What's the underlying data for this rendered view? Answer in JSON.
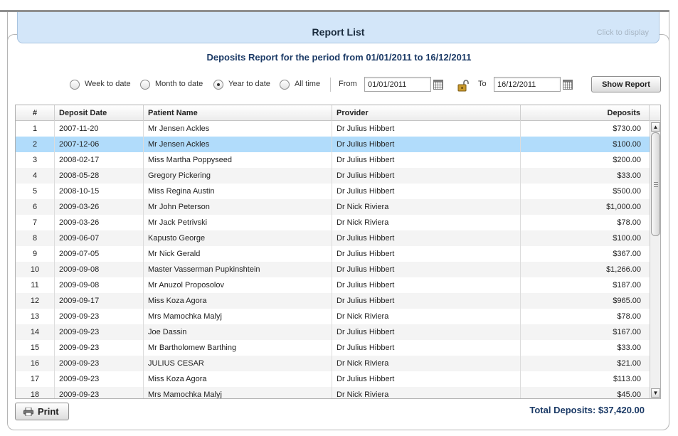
{
  "header": {
    "title": "Report List",
    "hint": "Click to display"
  },
  "report": {
    "title": "Deposits Report for the period from 01/01/2011 to 16/12/2011"
  },
  "filters": {
    "options": [
      {
        "label": "Week to date",
        "checked": false
      },
      {
        "label": "Month to date",
        "checked": false
      },
      {
        "label": "Year to date",
        "checked": true
      },
      {
        "label": "All time",
        "checked": false
      }
    ],
    "from_label": "From",
    "from_value": "01/01/2011",
    "to_label": "To",
    "to_value": "16/12/2011",
    "show_button": "Show Report"
  },
  "table": {
    "columns": [
      "#",
      "Deposit Date",
      "Patient Name",
      "Provider",
      "Deposits"
    ],
    "selected_row": 2,
    "rows": [
      [
        "1",
        "2007-11-20",
        "Mr Jensen Ackles",
        "Dr Julius Hibbert",
        "$730.00"
      ],
      [
        "2",
        "2007-12-06",
        "Mr Jensen Ackles",
        "Dr Julius Hibbert",
        "$100.00"
      ],
      [
        "3",
        "2008-02-17",
        "Miss Martha Poppyseed",
        "Dr Julius Hibbert",
        "$200.00"
      ],
      [
        "4",
        "2008-05-28",
        "Gregory Pickering",
        "Dr Julius Hibbert",
        "$33.00"
      ],
      [
        "5",
        "2008-10-15",
        "Miss Regina Austin",
        "Dr Julius Hibbert",
        "$500.00"
      ],
      [
        "6",
        "2009-03-26",
        "Mr John Peterson",
        "Dr Nick Riviera",
        "$1,000.00"
      ],
      [
        "7",
        "2009-03-26",
        "Mr Jack Petrivski",
        "Dr Nick Riviera",
        "$78.00"
      ],
      [
        "8",
        "2009-06-07",
        "Kapusto George",
        "Dr Julius Hibbert",
        "$100.00"
      ],
      [
        "9",
        "2009-07-05",
        "Mr Nick Gerald",
        "Dr Julius Hibbert",
        "$367.00"
      ],
      [
        "10",
        "2009-09-08",
        "Master Vasserman Pupkinshtein",
        "Dr Julius Hibbert",
        "$1,266.00"
      ],
      [
        "11",
        "2009-09-08",
        "Mr Anuzol Proposolov",
        "Dr Julius Hibbert",
        "$187.00"
      ],
      [
        "12",
        "2009-09-17",
        "Miss Koza Agora",
        "Dr Julius Hibbert",
        "$965.00"
      ],
      [
        "13",
        "2009-09-23",
        "Mrs Mamochka Malyj",
        "Dr Nick Riviera",
        "$78.00"
      ],
      [
        "14",
        "2009-09-23",
        "Joe Dassin",
        "Dr Julius Hibbert",
        "$167.00"
      ],
      [
        "15",
        "2009-09-23",
        "Mr Bartholomew Barthing",
        "Dr Julius Hibbert",
        "$33.00"
      ],
      [
        "16",
        "2009-09-23",
        "JULIUS CESAR",
        "Dr Nick Riviera",
        "$21.00"
      ],
      [
        "17",
        "2009-09-23",
        "Miss Koza Agora",
        "Dr Julius Hibbert",
        "$113.00"
      ],
      [
        "18",
        "2009-09-23",
        "Mrs Mamochka Malyj",
        "Dr Nick Riviera",
        "$45.00"
      ]
    ]
  },
  "footer": {
    "print_label": "Print",
    "total": "Total Deposits: $37,420.00"
  },
  "colors": {
    "header_bg": "#d3e6f9",
    "selected_row": "#b1dcfb",
    "title_text": "#1b3a66"
  },
  "icons": [
    "calendar-icon",
    "lock-icon",
    "printer-icon",
    "scroll-up-arrow-icon",
    "scroll-down-arrow-icon"
  ]
}
